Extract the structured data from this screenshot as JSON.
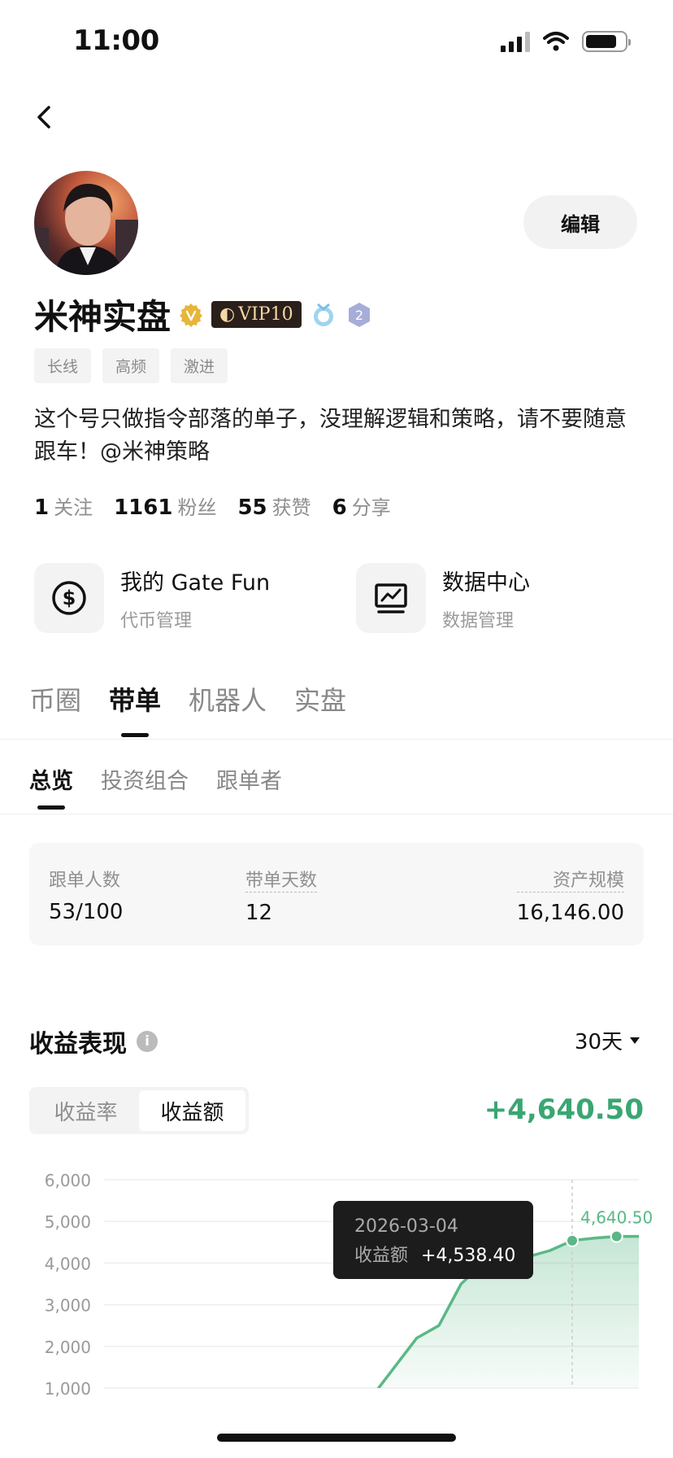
{
  "status": {
    "time": "11:00"
  },
  "profile": {
    "name": "米神实盘",
    "vip": "VIP10",
    "medal_level": "2",
    "edit_label": "编辑",
    "tags": [
      "长线",
      "高频",
      "激进"
    ],
    "bio": "这个号只做指令部落的单子，没理解逻辑和策略，请不要随意跟车！@米神策略",
    "stats": [
      {
        "value": "1",
        "label": "关注"
      },
      {
        "value": "1161",
        "label": "粉丝"
      },
      {
        "value": "55",
        "label": "获赞"
      },
      {
        "value": "6",
        "label": "分享"
      }
    ]
  },
  "features": [
    {
      "title": "我的 Gate Fun",
      "subtitle": "代币管理",
      "icon": "dollar-coin-icon"
    },
    {
      "title": "数据中心",
      "subtitle": "数据管理",
      "icon": "chart-monitor-icon"
    }
  ],
  "main_tabs": [
    "币圈",
    "带单",
    "机器人",
    "实盘"
  ],
  "active_main_tab": "带单",
  "sub_tabs": [
    "总览",
    "投资组合",
    "跟单者"
  ],
  "active_sub_tab": "总览",
  "overview": [
    {
      "label": "跟单人数",
      "value": "53/100"
    },
    {
      "label": "带单天数",
      "value": "12"
    },
    {
      "label": "资产规模",
      "value": "16,146.00"
    }
  ],
  "performance": {
    "title": "收益表现",
    "period": "30天",
    "toggle": [
      "收益率",
      "收益额"
    ],
    "active_toggle": "收益额",
    "total": "+4,640.50"
  },
  "chart_data": {
    "type": "area",
    "yticks": [
      "6,000",
      "5,000",
      "4,000",
      "3,000",
      "2,000",
      "1,000"
    ],
    "ylim": [
      1000,
      6000
    ],
    "series": [
      {
        "values": [
          800,
          1500,
          2200,
          2500,
          3500,
          4000,
          4150,
          4150,
          4300,
          4538.4,
          4600,
          4640.5,
          4640.5
        ]
      }
    ],
    "tooltip": {
      "date": "2026-03-04",
      "label": "收益额",
      "value": "+4,538.40"
    },
    "last_label": "4,640.50",
    "color": "#5bb886"
  }
}
